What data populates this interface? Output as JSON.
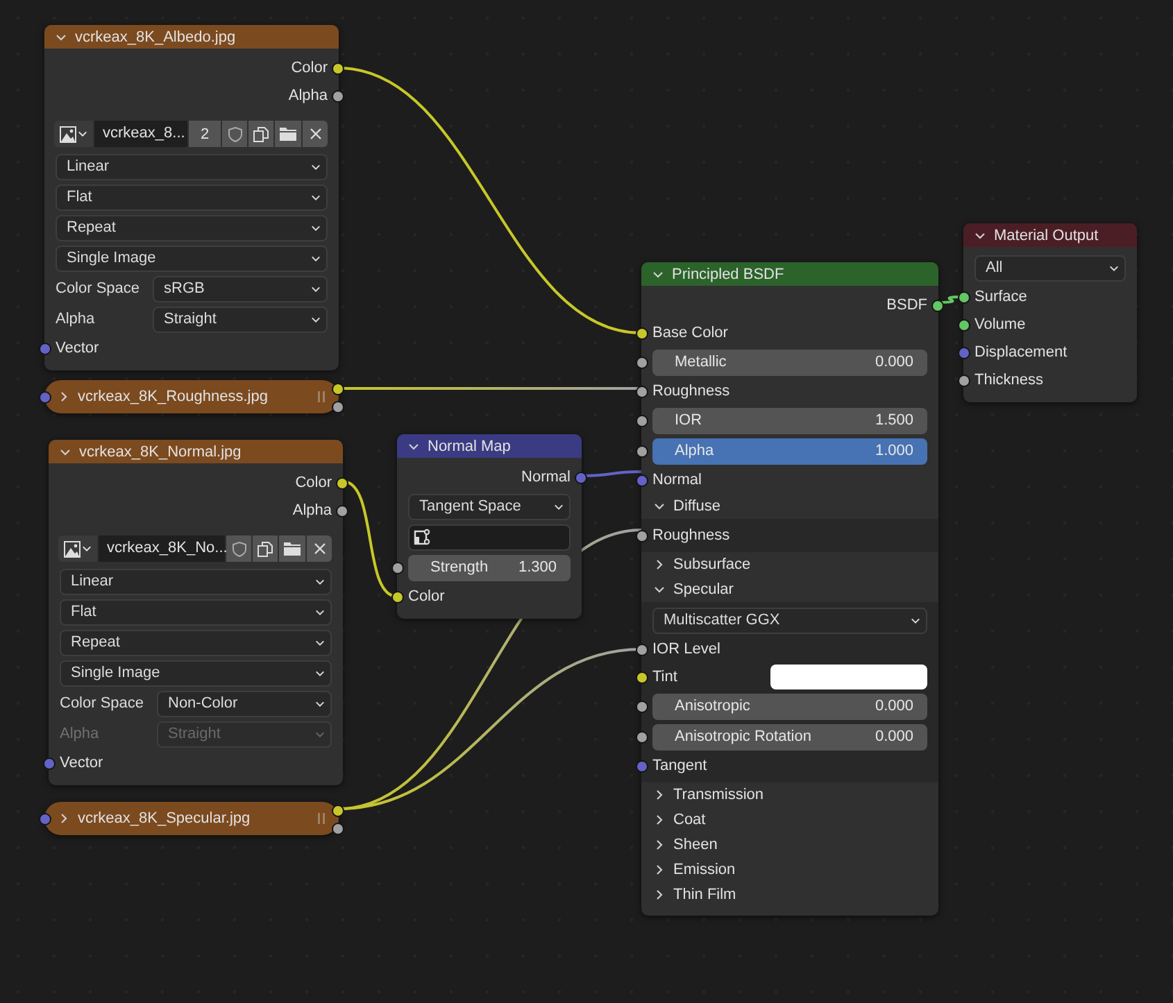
{
  "nodes": [
    {
      "color": "#7c4a1f",
      "title": "vcrkeax_8K_Albedo.jpg",
      "expanded": true,
      "rows": [
        {
          "kind": "output",
          "name": "Color",
          "color": "#c7c729"
        },
        {
          "kind": "output",
          "name": "Alpha",
          "color": "#a1a1a1"
        },
        {
          "kind": "image_selector",
          "image": "vcrkeax_8...",
          "users": "2"
        },
        {
          "kind": "dropdown",
          "value": "Linear"
        },
        {
          "kind": "dropdown",
          "value": "Flat"
        },
        {
          "kind": "dropdown",
          "value": "Repeat"
        },
        {
          "kind": "dropdown",
          "value": "Single Image"
        },
        {
          "kind": "property",
          "label": "Color Space",
          "value": "sRGB",
          "disabled": false
        },
        {
          "kind": "property",
          "label": "Alpha",
          "value": "Straight",
          "disabled": false
        },
        {
          "kind": "input",
          "name": "Vector",
          "color": "#6363c7"
        }
      ]
    },
    {
      "color": "#7c4a1f",
      "title": "vcrkeax_8K_Roughness.jpg",
      "expanded": false
    },
    {
      "color": "#7c4a1f",
      "title": "vcrkeax_8K_Normal.jpg",
      "expanded": true,
      "rows": [
        {
          "kind": "output",
          "name": "Color",
          "color": "#c7c729"
        },
        {
          "kind": "output",
          "name": "Alpha",
          "color": "#a1a1a1"
        },
        {
          "kind": "image_selector",
          "image": "vcrkeax_8K_No..."
        },
        {
          "kind": "dropdown",
          "value": "Linear"
        },
        {
          "kind": "dropdown",
          "value": "Flat"
        },
        {
          "kind": "dropdown",
          "value": "Repeat"
        },
        {
          "kind": "dropdown",
          "value": "Single Image"
        },
        {
          "kind": "property",
          "label": "Color Space",
          "value": "Non-Color",
          "disabled": false
        },
        {
          "kind": "property",
          "label": "Alpha",
          "value": "Straight",
          "disabled": true
        },
        {
          "kind": "input",
          "name": "Vector",
          "color": "#6363c7"
        }
      ]
    },
    {
      "color": "#7c4a1f",
      "title": "vcrkeax_8K_Specular.jpg",
      "expanded": false
    },
    {
      "color": "#3b3b84",
      "title": "Normal Map",
      "expanded": true,
      "rows": [
        {
          "kind": "output",
          "name": "Normal",
          "color": "#6363c7"
        },
        {
          "kind": "dropdown",
          "value": "Tangent Space"
        },
        {
          "kind": "uv_field"
        },
        {
          "kind": "slider",
          "name": "Strength",
          "value": "1.300",
          "color": "#a1a1a1",
          "selected": false
        },
        {
          "kind": "input",
          "name": "Color",
          "color": "#c7c729"
        }
      ]
    },
    {
      "color": "#2b632b",
      "title": "Principled BSDF",
      "expanded": true,
      "rows": [
        {
          "kind": "output",
          "name": "BSDF",
          "color": "#63c763"
        },
        {
          "kind": "input",
          "name": "Base Color",
          "color": "#c7c729"
        },
        {
          "kind": "slider",
          "name": "Metallic",
          "value": "0.000",
          "color": "#a1a1a1",
          "selected": false
        },
        {
          "kind": "input",
          "name": "Roughness",
          "color": "#a1a1a1"
        },
        {
          "kind": "slider",
          "name": "IOR",
          "value": "1.500",
          "color": "#a1a1a1",
          "selected": false
        },
        {
          "kind": "slider",
          "name": "Alpha",
          "value": "1.000",
          "color": "#a1a1a1",
          "selected": true
        },
        {
          "kind": "input",
          "name": "Normal",
          "color": "#6363c7"
        },
        {
          "kind": "panel",
          "label": "Diffuse",
          "expanded": true,
          "rows": [
            {
              "kind": "input",
              "name": "Roughness",
              "color": "#a1a1a1"
            }
          ]
        },
        {
          "kind": "panel",
          "label": "Subsurface",
          "expanded": false
        },
        {
          "kind": "panel",
          "label": "Specular",
          "expanded": true,
          "rows": [
            {
              "kind": "dropdown",
              "value": "Multiscatter GGX"
            },
            {
              "kind": "input",
              "name": "IOR Level",
              "color": "#a1a1a1"
            },
            {
              "kind": "color_input",
              "name": "Tint",
              "color": "#c7c729"
            },
            {
              "kind": "slider",
              "name": "Anisotropic",
              "value": "0.000",
              "color": "#a1a1a1",
              "selected": false
            },
            {
              "kind": "slider",
              "name": "Anisotropic Rotation",
              "value": "0.000",
              "color": "#a1a1a1",
              "selected": false
            },
            {
              "kind": "input",
              "name": "Tangent",
              "color": "#6363c7"
            }
          ]
        },
        {
          "kind": "panel",
          "label": "Transmission",
          "expanded": false
        },
        {
          "kind": "panel",
          "label": "Coat",
          "expanded": false
        },
        {
          "kind": "panel",
          "label": "Sheen",
          "expanded": false
        },
        {
          "kind": "panel",
          "label": "Emission",
          "expanded": false
        },
        {
          "kind": "panel",
          "label": "Thin Film",
          "expanded": false
        }
      ]
    },
    {
      "color": "#4b1e25",
      "title": "Material Output",
      "expanded": true,
      "rows": [
        {
          "kind": "dropdown",
          "value": "All"
        },
        {
          "kind": "input",
          "name": "Surface",
          "color": "#63c763"
        },
        {
          "kind": "input",
          "name": "Volume",
          "color": "#63c763"
        },
        {
          "kind": "input",
          "name": "Displacement",
          "color": "#6363c7"
        },
        {
          "kind": "input",
          "name": "Thickness",
          "color": "#a1a1a1"
        }
      ]
    }
  ]
}
